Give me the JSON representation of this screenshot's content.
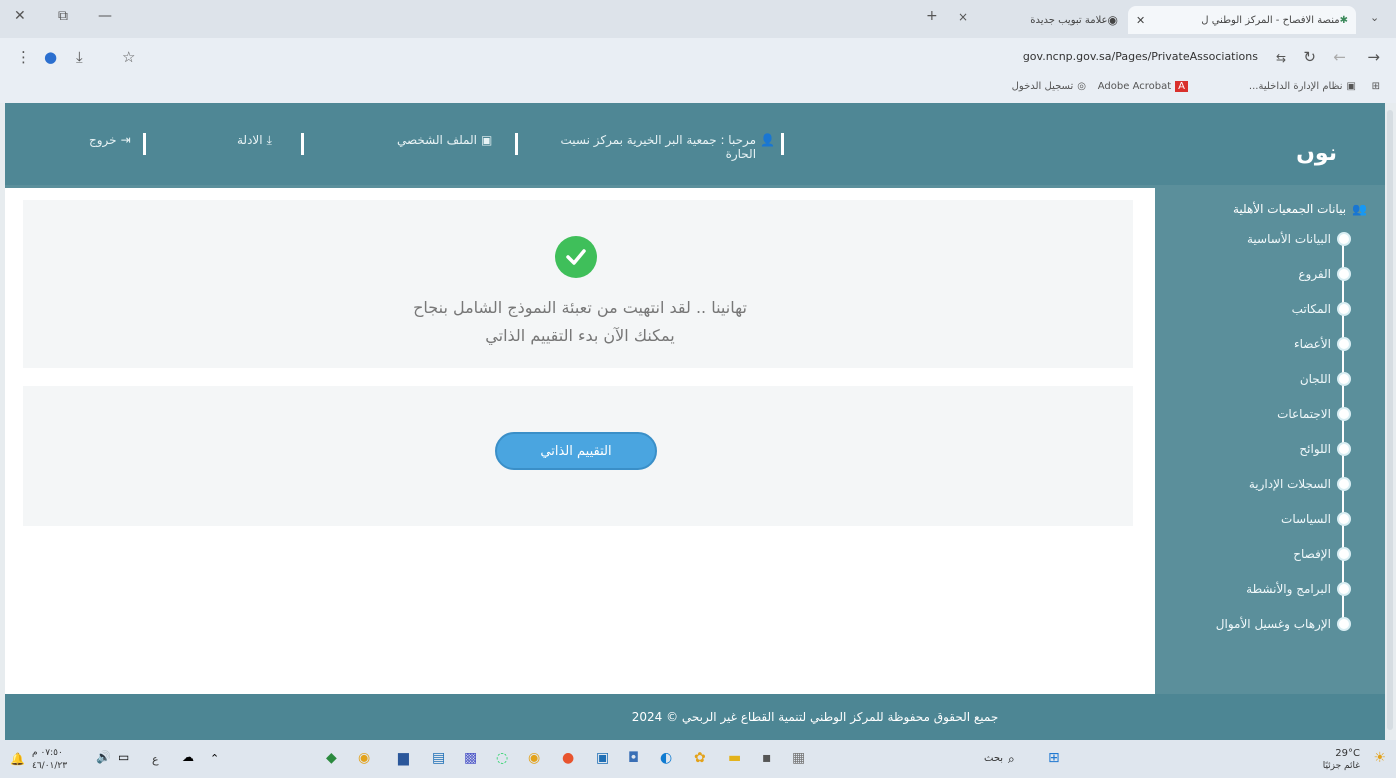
{
  "browser": {
    "tabs": [
      {
        "label": "منصة الافصاح - المركز الوطني ل",
        "active": true
      },
      {
        "label": "علامة تبويب جديدة",
        "active": false
      }
    ],
    "new_tab": "+",
    "close_tab": "×",
    "url": "gov.ncnp.gov.sa/Pages/PrivateAssociations",
    "bookmarks": [
      {
        "label": "نظام الإدارة الداخلية..."
      },
      {
        "label": "Adobe Acrobat"
      },
      {
        "label": "تسجيل الدخول"
      }
    ]
  },
  "header": {
    "logo": "نوں",
    "welcome": "مرحبا : جمعية البر الخيرية بمركز نسيت الحارة",
    "profile": "الملف الشخصي",
    "guide": "الادلة",
    "logout": "خروج"
  },
  "sidebar": {
    "title": "بيانات الجمعيات الأهلية",
    "items": [
      {
        "label": "البيانات الأساسية"
      },
      {
        "label": "الفروع"
      },
      {
        "label": "المكاتب"
      },
      {
        "label": "الأعضاء"
      },
      {
        "label": "اللجان"
      },
      {
        "label": "الاجتماعات"
      },
      {
        "label": "اللوائح"
      },
      {
        "label": "السجلات الإدارية"
      },
      {
        "label": "السياسات"
      },
      {
        "label": "الإفصاح"
      },
      {
        "label": "البرامج والأنشطة"
      },
      {
        "label": "الإرهاب وغسيل الأموال"
      }
    ]
  },
  "main": {
    "message_line1": "تهانينا .. لقد انتهيت من تعبئة النموذج الشامل بنجاح",
    "message_line2": "يمكنك الآن بدء التقييم الذاتي",
    "button_label": "التقييم الذاتي"
  },
  "footer": {
    "text": "جميع الحقوق محفوظة للمركز الوطني لتنمية القطاع غير الربحي © 2024"
  },
  "taskbar": {
    "weather_temp": "29°C",
    "weather_desc": "غائم جزئيًا",
    "search_label": "بحث",
    "time": "٠٧:٥٠ م",
    "date": "٤٦/٠١/٢٣",
    "lang": "ع"
  },
  "colors": {
    "header_bg": "#4f8795",
    "accent_button": "#4aa5e0",
    "success": "#3fbf5a"
  }
}
